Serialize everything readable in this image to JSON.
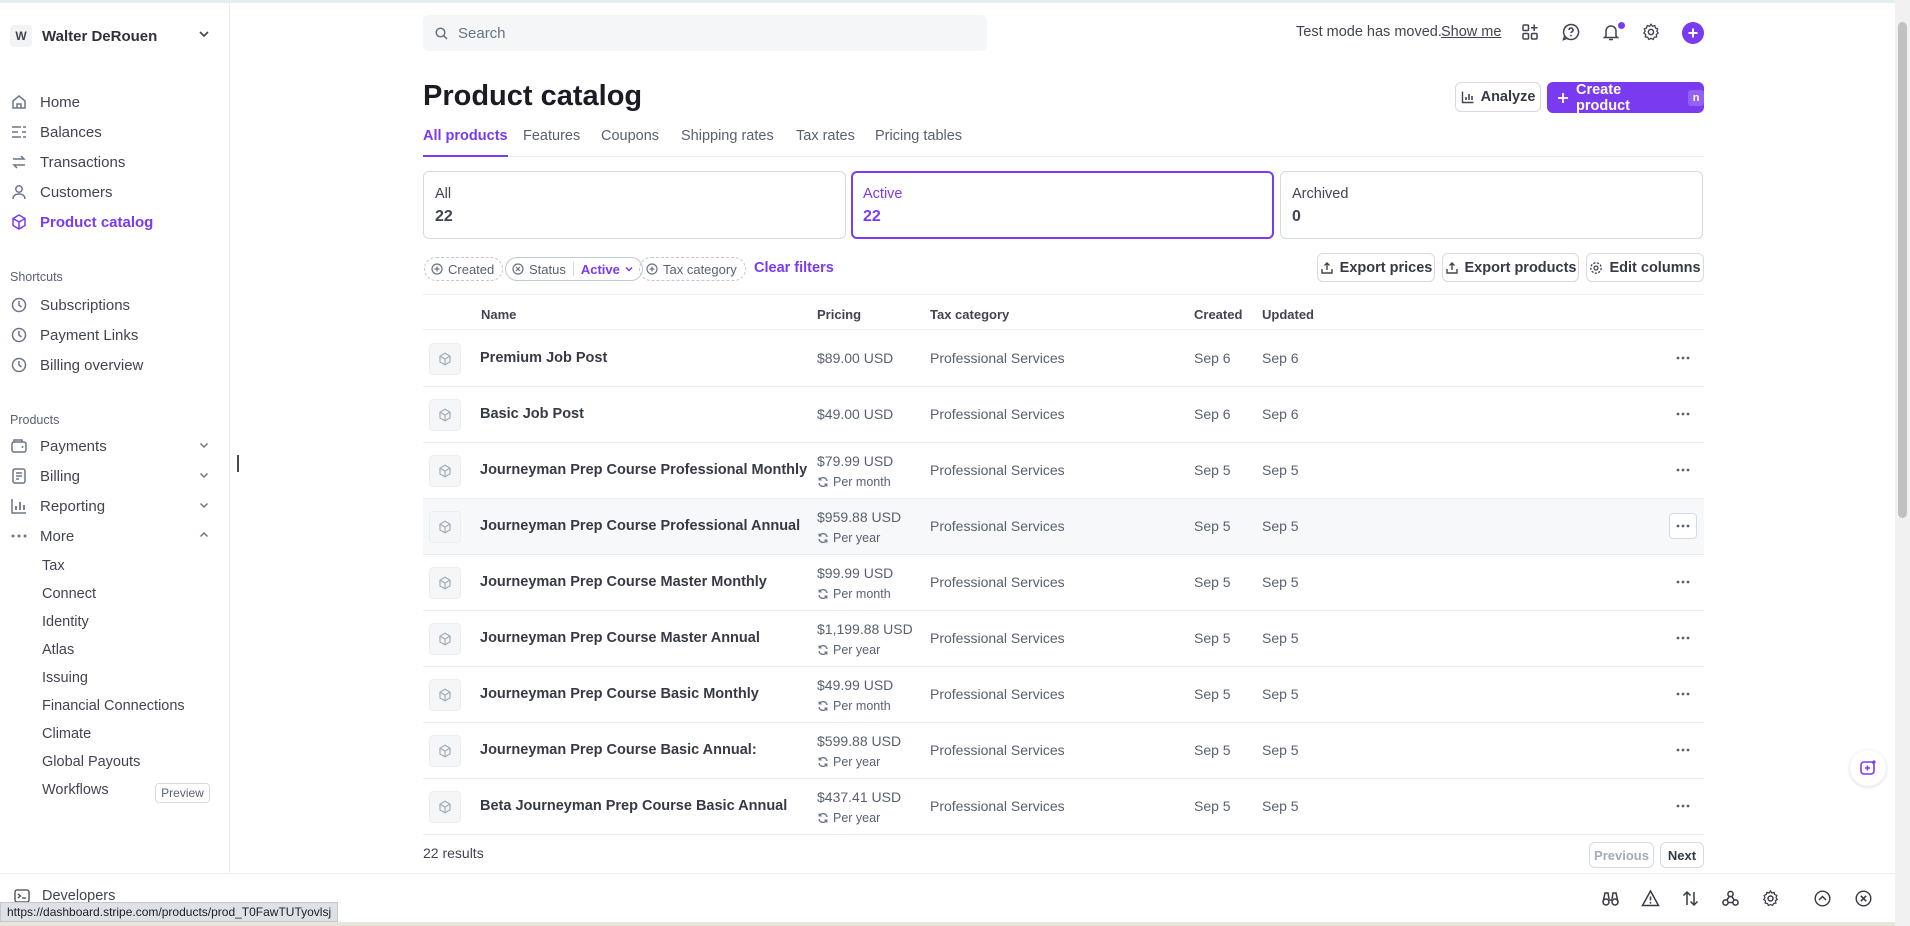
{
  "account": {
    "initial": "W",
    "name": "Walter DeRouen"
  },
  "sidebar": {
    "main": [
      {
        "label": "Home",
        "icon": "home-icon"
      },
      {
        "label": "Balances",
        "icon": "balances-icon"
      },
      {
        "label": "Transactions",
        "icon": "transactions-icon"
      },
      {
        "label": "Customers",
        "icon": "customers-icon"
      },
      {
        "label": "Product catalog",
        "icon": "product-catalog-icon",
        "active": true
      }
    ],
    "shortcuts_title": "Shortcuts",
    "shortcuts": [
      {
        "label": "Subscriptions",
        "icon": "clock-icon"
      },
      {
        "label": "Payment Links",
        "icon": "clock-icon"
      },
      {
        "label": "Billing overview",
        "icon": "clock-icon"
      }
    ],
    "products_title": "Products",
    "products": [
      {
        "label": "Payments",
        "icon": "payments-icon"
      },
      {
        "label": "Billing",
        "icon": "billing-icon"
      },
      {
        "label": "Reporting",
        "icon": "reporting-icon"
      },
      {
        "label": "More",
        "icon": "more-dots-icon"
      }
    ],
    "more_items": [
      "Tax",
      "Connect",
      "Identity",
      "Atlas",
      "Issuing",
      "Financial Connections",
      "Climate",
      "Global Payouts",
      "Workflows"
    ],
    "preview_badge": "Preview"
  },
  "topbar": {
    "search_placeholder": "Search",
    "test_mode_text": "Test mode has moved.",
    "show_me": "Show me"
  },
  "header": {
    "title": "Product catalog",
    "analyze": "Analyze",
    "create_product": "Create product",
    "create_shortcut": "n"
  },
  "tabs": [
    "All products",
    "Features",
    "Coupons",
    "Shipping rates",
    "Tax rates",
    "Pricing tables"
  ],
  "status_cards": [
    {
      "label": "All",
      "count": "22"
    },
    {
      "label": "Active",
      "count": "22"
    },
    {
      "label": "Archived",
      "count": "0"
    }
  ],
  "filters": {
    "created": "Created",
    "status": "Status",
    "status_value": "Active",
    "tax_category": "Tax category",
    "clear": "Clear filters",
    "export_prices": "Export prices",
    "export_products": "Export products",
    "edit_columns": "Edit columns"
  },
  "table": {
    "columns": [
      "Name",
      "Pricing",
      "Tax category",
      "Created",
      "Updated"
    ],
    "rows": [
      {
        "name": "Premium Job Post",
        "price": "$89.00 USD",
        "interval": "",
        "tax": "Professional Services",
        "created": "Sep 6",
        "updated": "Sep 6"
      },
      {
        "name": "Basic Job Post",
        "price": "$49.00 USD",
        "interval": "",
        "tax": "Professional Services",
        "created": "Sep 6",
        "updated": "Sep 6"
      },
      {
        "name": "Journeyman Prep Course Professional Monthly",
        "price": "$79.99 USD",
        "interval": "Per month",
        "tax": "Professional Services",
        "created": "Sep 5",
        "updated": "Sep 5"
      },
      {
        "name": "Journeyman Prep Course Professional Annual",
        "price": "$959.88 USD",
        "interval": "Per year",
        "tax": "Professional Services",
        "created": "Sep 5",
        "updated": "Sep 5"
      },
      {
        "name": "Journeyman Prep Course Master Monthly",
        "price": "$99.99 USD",
        "interval": "Per month",
        "tax": "Professional Services",
        "created": "Sep 5",
        "updated": "Sep 5"
      },
      {
        "name": "Journeyman Prep Course Master Annual",
        "price": "$1,199.88 USD",
        "interval": "Per year",
        "tax": "Professional Services",
        "created": "Sep 5",
        "updated": "Sep 5"
      },
      {
        "name": "Journeyman Prep Course Basic Monthly",
        "price": "$49.99 USD",
        "interval": "Per month",
        "tax": "Professional Services",
        "created": "Sep 5",
        "updated": "Sep 5"
      },
      {
        "name": "Journeyman Prep Course Basic Annual:",
        "price": "$599.88 USD",
        "interval": "Per year",
        "tax": "Professional Services",
        "created": "Sep 5",
        "updated": "Sep 5"
      },
      {
        "name": "Beta Journeyman Prep Course Basic Annual",
        "price": "$437.41 USD",
        "interval": "Per year",
        "tax": "Professional Services",
        "created": "Sep 5",
        "updated": "Sep 5"
      }
    ]
  },
  "pagination": {
    "results": "22 results",
    "previous": "Previous",
    "next": "Next"
  },
  "bottombar": {
    "developers": "Developers"
  },
  "status_url": "https://dashboard.stripe.com/products/prod_T0FawTUTyovlsj",
  "colors": {
    "accent": "#7a3af0",
    "text": "#353a44",
    "muted": "#596171",
    "border": "#d5dbe1"
  }
}
